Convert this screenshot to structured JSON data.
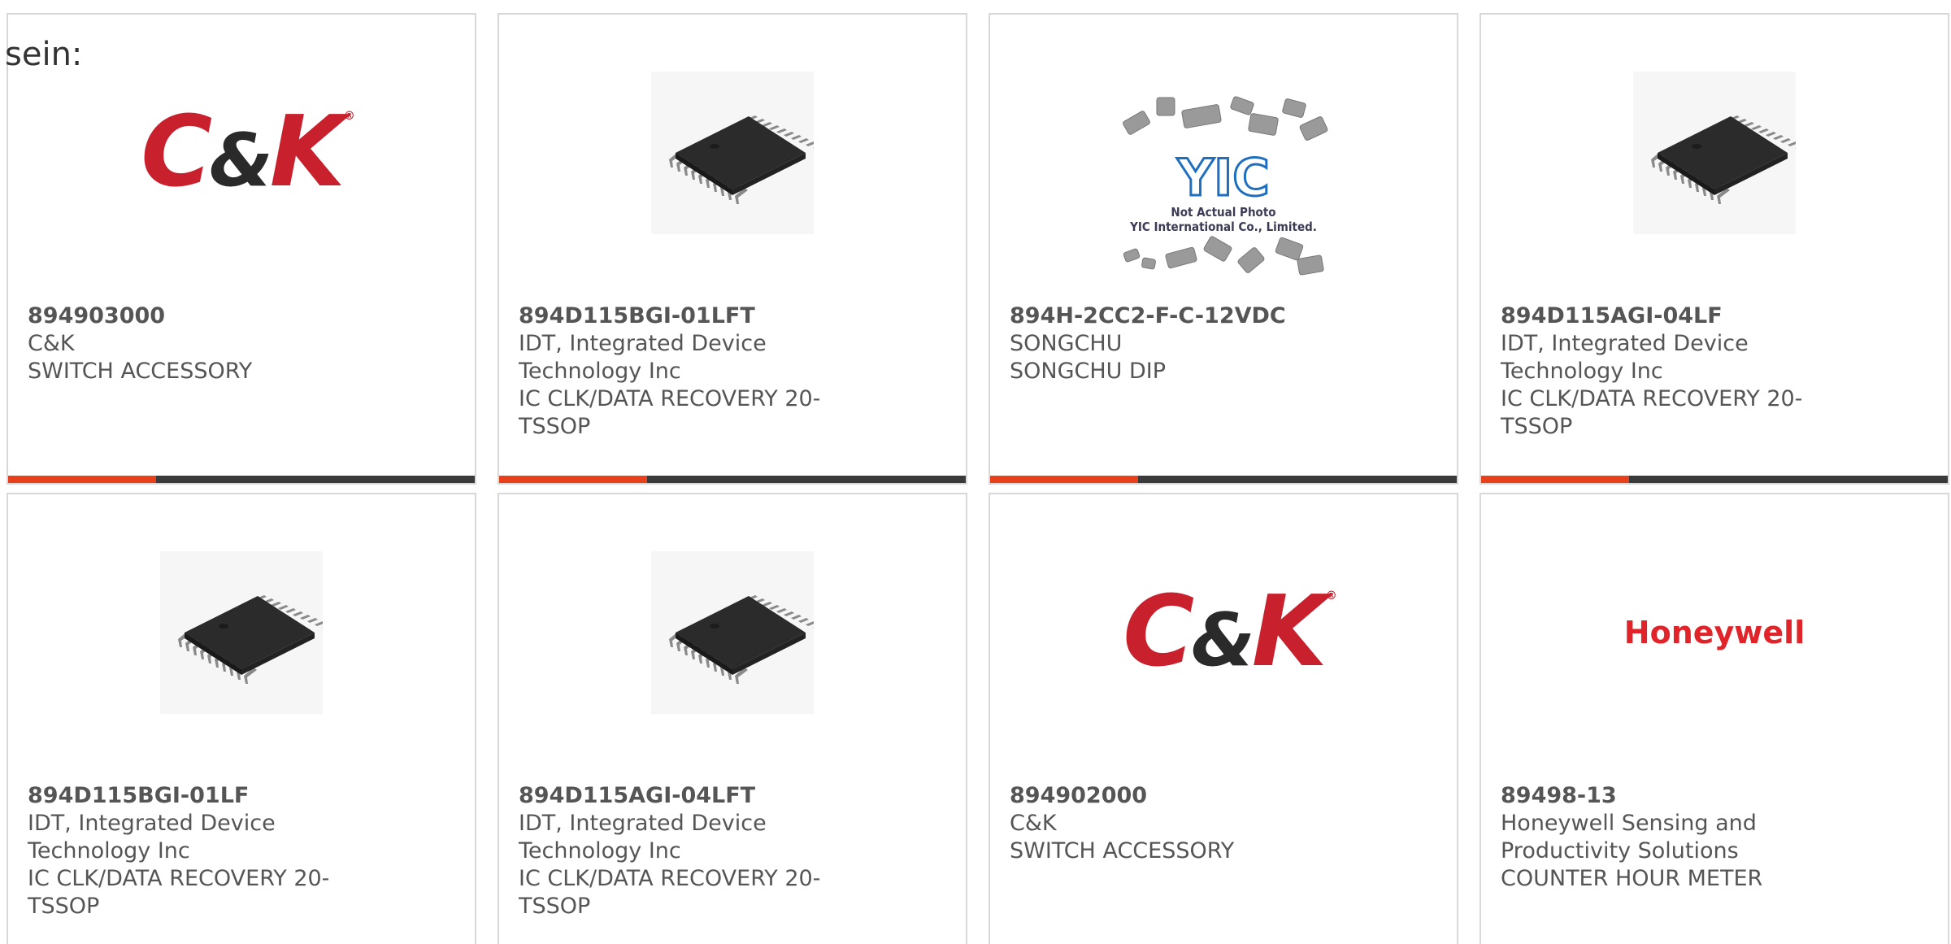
{
  "page": {
    "heading": "sein:"
  },
  "accent_color": "#e8401a",
  "bar_color": "#3a3a3a",
  "products": [
    {
      "part_number": "894903000",
      "manufacturer": "C&K",
      "description": "SWITCH ACCESSORY",
      "image": "ck-logo"
    },
    {
      "part_number": "894D115BGI-01LFT",
      "manufacturer": "IDT, Integrated Device Technology Inc",
      "description": "IC CLK/DATA RECOVERY 20-TSSOP",
      "image": "tssop-chip"
    },
    {
      "part_number": "894H-2CC2-F-C-12VDC",
      "manufacturer": "SONGCHU",
      "description": "SONGCHU DIP",
      "image": "yic-placeholder",
      "image_caption_1": "Not Actual Photo",
      "image_caption_2": "YIC International Co., Limited.",
      "image_logo_text": "YIC"
    },
    {
      "part_number": "894D115AGI-04LF",
      "manufacturer": "IDT, Integrated Device Technology Inc",
      "description": "IC CLK/DATA RECOVERY 20-TSSOP",
      "image": "tssop-chip"
    },
    {
      "part_number": "894D115BGI-01LF",
      "manufacturer": "IDT, Integrated Device Technology Inc",
      "description": "IC CLK/DATA RECOVERY 20-TSSOP",
      "image": "tssop-chip"
    },
    {
      "part_number": "894D115AGI-04LFT",
      "manufacturer": "IDT, Integrated Device Technology Inc",
      "description": "IC CLK/DATA RECOVERY 20-TSSOP",
      "image": "tssop-chip"
    },
    {
      "part_number": "894902000",
      "manufacturer": "C&K",
      "description": "SWITCH ACCESSORY",
      "image": "ck-logo"
    },
    {
      "part_number": "89498-13",
      "manufacturer": "Honeywell Sensing and Productivity Solutions",
      "description": "COUNTER HOUR METER",
      "image": "honeywell-logo",
      "image_logo_text": "Honeywell"
    }
  ],
  "logos": {
    "ck_main": "C",
    "ck_amp": "&",
    "ck_end": "K",
    "ck_reg": "®"
  }
}
